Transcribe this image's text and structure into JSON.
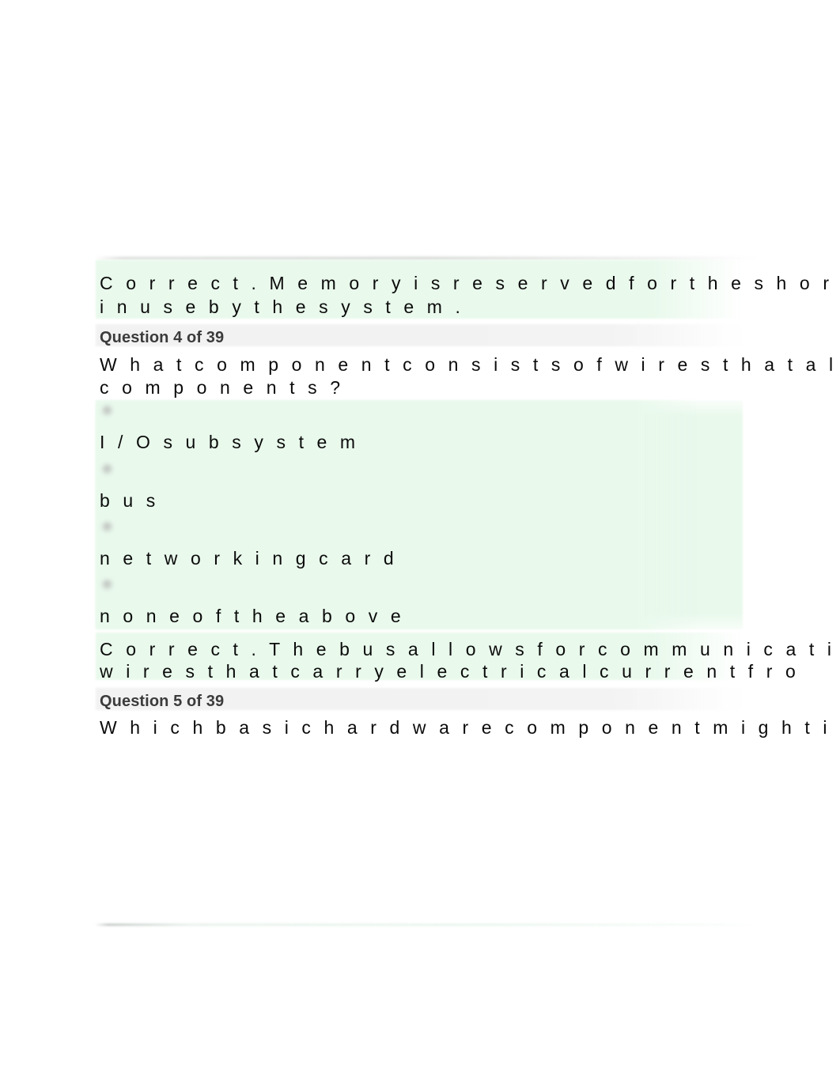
{
  "document": {
    "type": "quiz-review",
    "background": "#ffffff",
    "highlight_color": "#e9f9ec",
    "question_band_color": "#f2f2f2",
    "text_color": "#0b0b0b",
    "heading_color": "#3b3b3b"
  },
  "blocks": [
    {
      "kind": "feedback",
      "id": "feedback-q3",
      "lines": [
        "C o r r e c t .   M e m o r y   i s   r e s e r v e d   f o r   t h e   s h o r",
        "i n   u s e   b y   t h e   s y s t e m ."
      ]
    },
    {
      "kind": "question",
      "id": "question-4",
      "header": "Question 4 of 39",
      "prompt_lines": [
        "W h a t   c o m p o n e n t   c o n s i s t s   o f   w i r e s   t h a t   a l",
        "c o m p o n e n t s ?"
      ],
      "options": [
        {
          "id": "opt-a",
          "label": "I / O   s u b s y s t e m",
          "selected": false
        },
        {
          "id": "opt-b",
          "label": "b u s",
          "selected": false
        },
        {
          "id": "opt-c",
          "label": "n e t w o r k i n g   c a r d",
          "selected": false
        },
        {
          "id": "opt-d",
          "label": "n o n e   o f   t h e   a b o v e",
          "selected": false
        }
      ]
    },
    {
      "kind": "feedback",
      "id": "feedback-q4",
      "lines": [
        "C o r r e c t .   T h e   b u s   a l l o w s   f o r   c o m m u n i c a t i o",
        "w i r e s   t h a t   c a r r y   e l e c t r i c a l   c u r r e n t   f r o"
      ]
    },
    {
      "kind": "question",
      "id": "question-5",
      "header": "Question 5 of 39",
      "prompt_lines": [
        "W h i c h   b a s i c   h a r d w a r e   c o m p o n e n t   m i g h t   i n c"
      ],
      "options": []
    }
  ],
  "feedback_q3": {
    "line1": "C o r r e c t .   M e m o r y   i s   r e s e r v e d   f o r   t h e   s h o r",
    "line2": "i n   u s e   b y   t h e   s y s t e m ."
  },
  "question4": {
    "header": "Question 4 of 39",
    "prompt_line1": "W h a t   c o m p o n e n t   c o n s i s t s   o f   w i r e s   t h a t   a l",
    "prompt_line2": "c o m p o n e n t s ?",
    "option_a": "I / O   s u b s y s t e m",
    "option_b": "b u s",
    "option_c": "n e t w o r k i n g   c a r d",
    "option_d": "n o n e   o f   t h e   a b o v e"
  },
  "feedback_q4": {
    "line1": "C o r r e c t .   T h e   b u s   a l l o w s   f o r   c o m m u n i c a t i o",
    "line2": "w i r e s   t h a t   c a r r y   e l e c t r i c a l   c u r r e n t   f r o"
  },
  "question5": {
    "header": "Question 5 of 39",
    "prompt_line1": "W h i c h   b a s i c   h a r d w a r e   c o m p o n e n t   m i g h t   i n c"
  }
}
